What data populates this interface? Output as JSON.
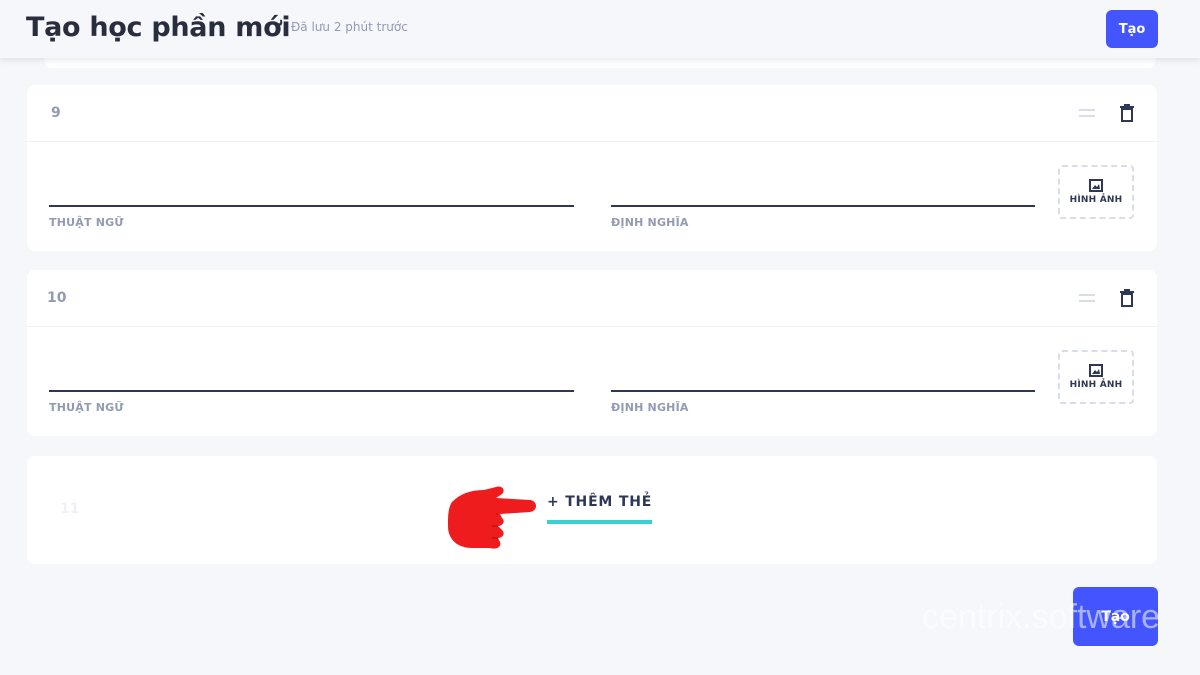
{
  "header": {
    "title": "Tạo học phần mới",
    "saved_status": "Đã lưu 2 phút trước",
    "create_label": "Tạo"
  },
  "cards": [
    {
      "number": "9",
      "term_label": "THUẬT NGỮ",
      "definition_label": "ĐỊNH NGHĨA",
      "image_label": "HÌNH ẢNH",
      "term_value": "",
      "definition_value": ""
    },
    {
      "number": "10",
      "term_label": "THUẬT NGỮ",
      "definition_label": "ĐỊNH NGHĨA",
      "image_label": "HÌNH ẢNH",
      "term_value": "",
      "definition_value": ""
    }
  ],
  "add_card": {
    "number": "11",
    "label": "+ THÊM THẺ"
  },
  "footer": {
    "create_label": "Tạo"
  },
  "watermark": "centrix.software",
  "icons": {
    "drag": "drag-handle-icon",
    "trash": "trash-icon",
    "image": "image-icon",
    "pointer": "pointing-hand-icon"
  },
  "colors": {
    "accent": "#4255ff",
    "underline": "#3ccfcf",
    "hand": "#ee1c1c",
    "text": "#2e3856",
    "muted": "#939bb4",
    "background": "#f6f7fb"
  }
}
